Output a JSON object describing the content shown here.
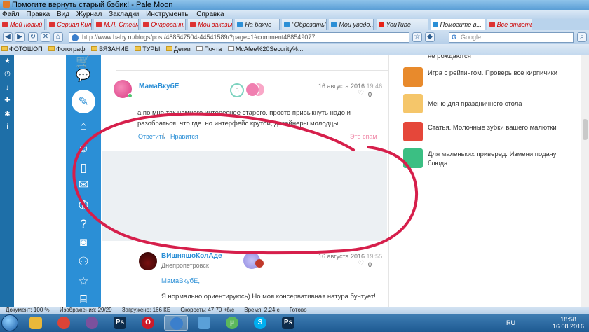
{
  "window": {
    "title": "Помогите вернуть старый бэбик! - Pale Moon"
  },
  "menu": [
    "Файл",
    "Правка",
    "Вид",
    "Журнал",
    "Закладки",
    "Инструменты",
    "Справка"
  ],
  "tabs": [
    {
      "label": "Мой новый ...",
      "color": "#d33"
    },
    {
      "label": "Сериал Кил...",
      "color": "#d33"
    },
    {
      "label": "М.Л. Стедм...",
      "color": "#d33"
    },
    {
      "label": "Очарованн...",
      "color": "#d33"
    },
    {
      "label": "Мои заказы",
      "color": "#d33"
    },
    {
      "label": "На бахче",
      "color": "#2b8fd6"
    },
    {
      "label": "\"Обрезать\" ...",
      "color": "#2b8fd6"
    },
    {
      "label": "Мои уведо...",
      "color": "#2b8fd6"
    },
    {
      "label": "YouTube",
      "color": "#e62117"
    },
    {
      "label": "Помогите в...",
      "color": "#2b8fd6"
    },
    {
      "label": "Все ответы",
      "color": "#d33"
    }
  ],
  "nav": {
    "url": "http://www.baby.ru/blogs/post/488547504-44541589/?page=1#comment488549077",
    "search_placeholder": "Google"
  },
  "bookmarks": [
    "ФОТОШОП",
    "Фотограф",
    "ВЯЗАНИЕ",
    "ТУРЫ",
    "Детки",
    "Почта",
    "McAfee%20Security%..."
  ],
  "comment1": {
    "user": "МамаВкубЕ",
    "badge": "5",
    "date": "16 августа 2016",
    "time": "19:46",
    "likes": "0",
    "text": "а по мне так намного интереснее старого. просто привыкнуть надо и разобраться, что где. но интерфейс крутой, дизайнеры молодцы",
    "reply": "Ответить",
    "like": "Нравится",
    "spam": "Это спам"
  },
  "comment2": {
    "user": "ВИшняшоКолАде",
    "city": "Днепропетровск",
    "date": "16 августа 2016",
    "time": "19:55",
    "likes": "0",
    "mention": "МамаВкубЕ,",
    "text": "Я нормально ориентируюсь) Но моя консервативная натура бунтует!"
  },
  "right": [
    {
      "text": "не рождаются"
    },
    {
      "text": "Игра с рейтингом. Проверь все кирпичики"
    },
    {
      "text": "Меню для праздничного стола"
    },
    {
      "text": "Статья. Молочные зубки вашего малютки"
    },
    {
      "text": "Для маленьких приверед. Измени подачу блюда"
    }
  ],
  "status": {
    "doc": "Документ: 100 %",
    "images": "Изображения: 29/29",
    "loaded": "Загружено: 166 КБ",
    "speed": "Скорость: 47,70 Кб/с",
    "time": "Время: 2,24 с",
    "ready": "Готово"
  },
  "taskbar": {
    "lang": "RU",
    "time": "18:58",
    "date": "16.08.2016"
  }
}
